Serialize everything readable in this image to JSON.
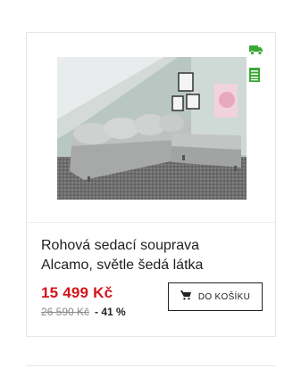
{
  "product": {
    "name_line1": "Rohová sedací souprava",
    "name_line2": "Alcamo, světle šedá látka",
    "price_current": "15 499 Kč",
    "price_old": "26 590 Kč",
    "discount": "- 41 %",
    "image_alt": "Rohová sedací souprava Alcamo"
  },
  "cart_button": {
    "label": "DO KOŠÍKU",
    "icon": "cart-icon"
  },
  "badges": [
    {
      "icon": "delivery-truck-icon",
      "color": "#3aa935"
    },
    {
      "icon": "stock-list-icon",
      "color": "#3aa935"
    }
  ],
  "colors": {
    "price": "#d5131c",
    "badge_green": "#3aa935",
    "border": "#e6e6e6"
  }
}
